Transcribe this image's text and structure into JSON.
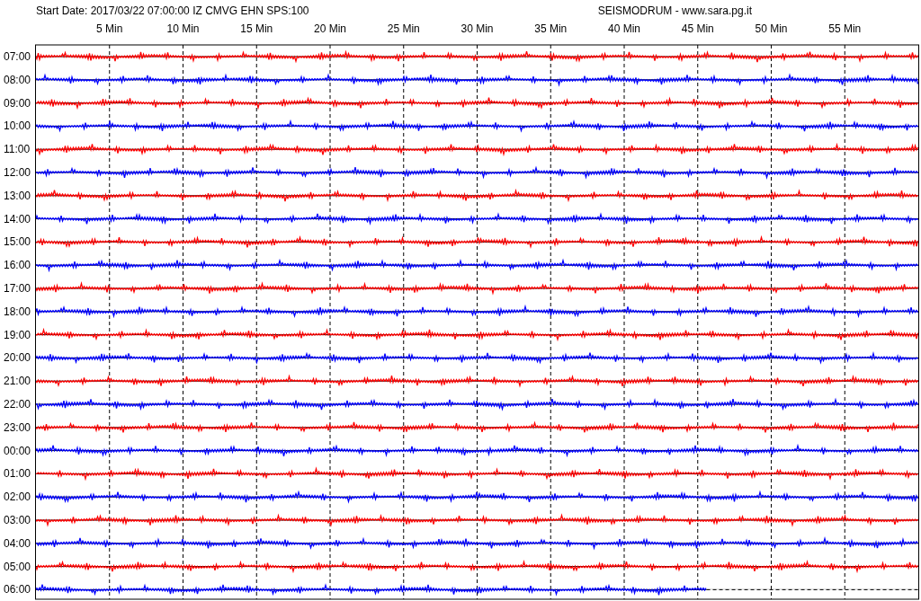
{
  "header": {
    "title": "Start Date: 2017/03/22 07:00:00 IZ CMVG EHN SPS:100",
    "source": "SEISMODRUM - www.sara.pg.it"
  },
  "minute_labels": [
    "5 Min",
    "10 Min",
    "15 Min",
    "20 Min",
    "25 Min",
    "30 Min",
    "35 Min",
    "40 Min",
    "45 Min",
    "50 Min",
    "55 Min"
  ],
  "rows": [
    {
      "hour": "07:00",
      "color": "#ff0000",
      "level": 1
    },
    {
      "hour": "08:00",
      "color": "#0000ff",
      "level": 1
    },
    {
      "hour": "09:00",
      "color": "#ff0000",
      "level": 1
    },
    {
      "hour": "10:00",
      "color": "#0000ff",
      "level": 1
    },
    {
      "hour": "11:00",
      "color": "#ff0000",
      "level": 1
    },
    {
      "hour": "12:00",
      "color": "#0000ff",
      "level": 1
    },
    {
      "hour": "13:00",
      "color": "#ff0000",
      "level": 1
    },
    {
      "hour": "14:00",
      "color": "#0000ff",
      "level": 1
    },
    {
      "hour": "15:00",
      "color": "#ff0000",
      "level": 1
    },
    {
      "hour": "16:00",
      "color": "#0000ff",
      "level": 1
    },
    {
      "hour": "17:00",
      "color": "#ff0000",
      "level": 1
    },
    {
      "hour": "18:00",
      "color": "#0000ff",
      "level": 1
    },
    {
      "hour": "19:00",
      "color": "#ff0000",
      "level": 1
    },
    {
      "hour": "20:00",
      "color": "#0000ff",
      "level": 1
    },
    {
      "hour": "21:00",
      "color": "#ff0000",
      "level": 1
    },
    {
      "hour": "22:00",
      "color": "#0000ff",
      "level": 1
    },
    {
      "hour": "23:00",
      "color": "#ff0000",
      "level": 1
    },
    {
      "hour": "00:00",
      "color": "#0000ff",
      "level": 1
    },
    {
      "hour": "01:00",
      "color": "#ff0000",
      "level": 1
    },
    {
      "hour": "02:00",
      "color": "#0000ff",
      "level": 1
    },
    {
      "hour": "03:00",
      "color": "#ff0000",
      "level": 1
    },
    {
      "hour": "04:00",
      "color": "#0000ff",
      "level": 1
    },
    {
      "hour": "05:00",
      "color": "#ff0000",
      "level": 1
    },
    {
      "hour": "06:00",
      "color": "#0000ff",
      "level": 0.76
    }
  ]
}
